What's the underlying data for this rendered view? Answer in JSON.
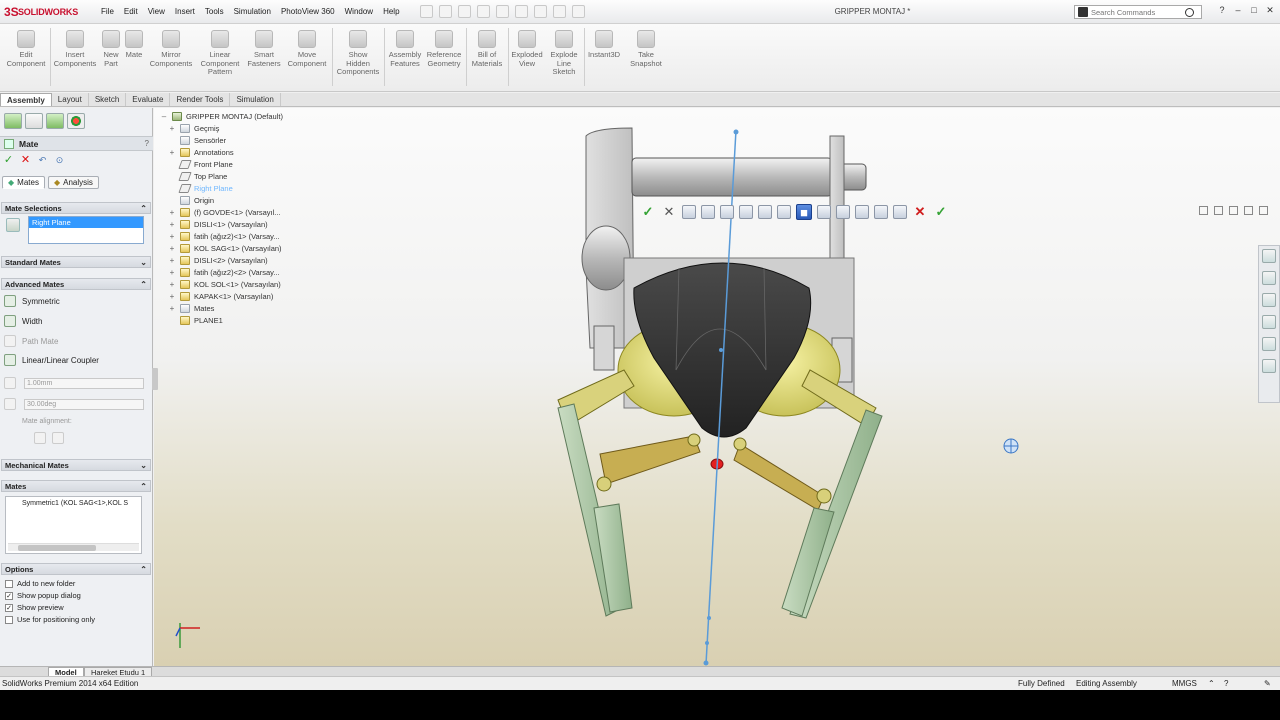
{
  "app": {
    "brand": "SOLIDWORKS",
    "doc_title": "GRIPPER MONTAJ *",
    "search_placeholder": "Search Commands"
  },
  "menu": [
    "File",
    "Edit",
    "View",
    "Insert",
    "Tools",
    "Simulation",
    "PhotoView 360",
    "Window",
    "Help"
  ],
  "ribbon": {
    "buttons": [
      {
        "l1": "Edit",
        "l2": "Component",
        "l3": ""
      },
      {
        "l1": "Insert",
        "l2": "Components",
        "l3": ""
      },
      {
        "l1": "New",
        "l2": "Part",
        "l3": ""
      },
      {
        "l1": "Mate",
        "l2": "",
        "l3": ""
      },
      {
        "l1": "Mirror",
        "l2": "Components",
        "l3": ""
      },
      {
        "l1": "Linear",
        "l2": "Component",
        "l3": "Pattern"
      },
      {
        "l1": "Smart",
        "l2": "Fasteners",
        "l3": ""
      },
      {
        "l1": "Move",
        "l2": "Component",
        "l3": ""
      },
      {
        "l1": "Show",
        "l2": "Hidden",
        "l3": "Components"
      },
      {
        "l1": "Assembly",
        "l2": "Features",
        "l3": ""
      },
      {
        "l1": "Reference",
        "l2": "Geometry",
        "l3": ""
      },
      {
        "l1": "Bill of",
        "l2": "Materials",
        "l3": ""
      },
      {
        "l1": "Exploded",
        "l2": "View",
        "l3": ""
      },
      {
        "l1": "Explode",
        "l2": "Line",
        "l3": "Sketch"
      },
      {
        "l1": "Instant3D",
        "l2": "",
        "l3": ""
      },
      {
        "l1": "Take",
        "l2": "Snapshot",
        "l3": ""
      }
    ]
  },
  "cm_tabs": [
    "Assembly",
    "Layout",
    "Sketch",
    "Evaluate",
    "Render Tools",
    "Simulation"
  ],
  "pm": {
    "title": "Mate",
    "help": "?",
    "tab_mates": "Mates",
    "tab_analysis": "Analysis",
    "mate_selections_head": "Mate Selections",
    "selection_value": "Right Plane",
    "standard_mates_head": "Standard Mates",
    "advanced_mates_head": "Advanced Mates",
    "adv": [
      "Symmetric",
      "Width",
      "Path Mate",
      "Linear/Linear Coupler"
    ],
    "dist_value": "1.00mm",
    "angle_value": "30.00deg",
    "mate_alignment": "Mate alignment:",
    "mechanical_mates_head": "Mechanical Mates",
    "mates_head": "Mates",
    "mates_item": "Symmetric1 (KOL SAG<1>,KOL S",
    "options_head": "Options",
    "options": [
      {
        "label": "Add to new folder",
        "checked": "false"
      },
      {
        "label": "Show popup dialog",
        "checked": "true"
      },
      {
        "label": "Show preview",
        "checked": "true"
      },
      {
        "label": "Use for positioning only",
        "checked": "false"
      }
    ]
  },
  "tree": {
    "root": "GRIPPER MONTAJ  (Default)",
    "items": [
      {
        "label": "Geçmiş",
        "exp": "+"
      },
      {
        "label": "Sensörler",
        "exp": ""
      },
      {
        "label": "Annotations",
        "exp": "+"
      },
      {
        "label": "Front Plane",
        "exp": ""
      },
      {
        "label": "Top Plane",
        "exp": ""
      },
      {
        "label": "Right Plane",
        "exp": ""
      },
      {
        "label": "Origin",
        "exp": ""
      },
      {
        "label": "(f) GOVDE<1> (Varsayıl...",
        "exp": "+"
      },
      {
        "label": "DISLI<1> (Varsayılan)",
        "exp": "+"
      },
      {
        "label": "fatih (ağız2)<1> (Varsay...",
        "exp": "+"
      },
      {
        "label": "KOL SAG<1> (Varsayılan)",
        "exp": "+"
      },
      {
        "label": "DISLI<2> (Varsayılan)",
        "exp": "+"
      },
      {
        "label": "fatih (ağız2)<2> (Varsay...",
        "exp": "+"
      },
      {
        "label": "KOL SOL<1> (Varsayılan)",
        "exp": "+"
      },
      {
        "label": "KAPAK<1> (Varsayılan)",
        "exp": "+"
      },
      {
        "label": "Mates",
        "exp": "+"
      },
      {
        "label": "PLANE1",
        "exp": ""
      }
    ]
  },
  "doc_tabs": [
    "Model",
    "Hareket Etudu 1"
  ],
  "status": {
    "edition": "SolidWorks Premium 2014 x64 Edition",
    "defined": "Fully Defined",
    "mode": "Editing Assembly",
    "units": "MMGS"
  },
  "colors": {
    "brand_red": "#c8102e",
    "selection_blue": "#3399ff",
    "accent_green": "#35a335"
  }
}
